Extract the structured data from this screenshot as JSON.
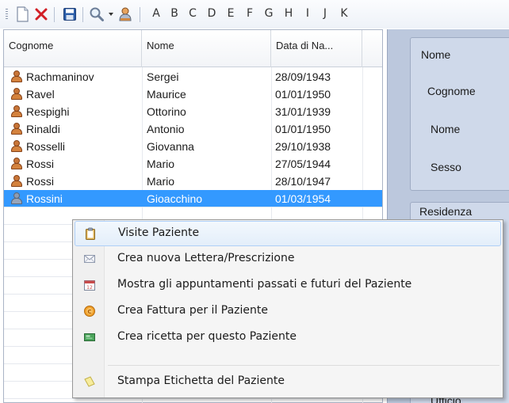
{
  "toolbar": {
    "buttons": [
      {
        "name": "new-document",
        "icon": "new-document-icon"
      },
      {
        "name": "delete",
        "icon": "red-x-icon"
      },
      {
        "name": "save",
        "icon": "floppy-disk-icon"
      },
      {
        "name": "search",
        "icon": "magnifier-icon"
      },
      {
        "name": "patient",
        "icon": "person-icon"
      }
    ],
    "letters": [
      "A",
      "B",
      "C",
      "D",
      "E",
      "F",
      "G",
      "H",
      "I",
      "J",
      "K"
    ]
  },
  "grid": {
    "columns": [
      {
        "key": "cognome",
        "label": "Cognome"
      },
      {
        "key": "nome",
        "label": "Nome"
      },
      {
        "key": "data",
        "label": "Data di Na..."
      }
    ],
    "rows": [
      {
        "cognome": "Rachmaninov",
        "nome": "Sergei",
        "data": "28/09/1943"
      },
      {
        "cognome": "Ravel",
        "nome": "Maurice",
        "data": "01/01/1950"
      },
      {
        "cognome": "Respighi",
        "nome": "Ottorino",
        "data": "31/01/1939"
      },
      {
        "cognome": "Rinaldi",
        "nome": "Antonio",
        "data": "01/01/1950"
      },
      {
        "cognome": "Rosselli",
        "nome": "Giovanna",
        "data": "29/10/1938"
      },
      {
        "cognome": "Rossi",
        "nome": "Mario",
        "data": "27/05/1944"
      },
      {
        "cognome": "Rossi",
        "nome": "Mario",
        "data": "28/10/1947"
      },
      {
        "cognome": "Rossini",
        "nome": "Gioacchino",
        "data": "01/03/1954",
        "selected": true
      }
    ]
  },
  "detail_panel": {
    "group1_title": "Nome",
    "labels": [
      "Cognome",
      "Nome",
      "Sesso"
    ],
    "group2_title": "Residenza",
    "bottom_label": "Ufficio"
  },
  "context_menu": {
    "items": [
      {
        "label": "Visite Paziente",
        "icon": "clipboard-icon",
        "hover": true
      },
      {
        "label": "Crea nuova Lettera/Prescrizione",
        "icon": "envelope-icon"
      },
      {
        "label": "Mostra gli appuntamenti passati e futuri del Paziente",
        "icon": "calendar-icon"
      },
      {
        "label": "Crea Fattura per il Paziente",
        "icon": "coin-icon"
      },
      {
        "label": "Crea ricetta per questo Paziente",
        "icon": "prescription-icon"
      },
      {
        "label": "Stampa Etichetta del Paziente",
        "icon": "label-tag-icon"
      }
    ]
  },
  "colors": {
    "selection": "#3399ff",
    "panel_bg": "#bcc8dd",
    "menu_hover_border": "#aecff7"
  }
}
